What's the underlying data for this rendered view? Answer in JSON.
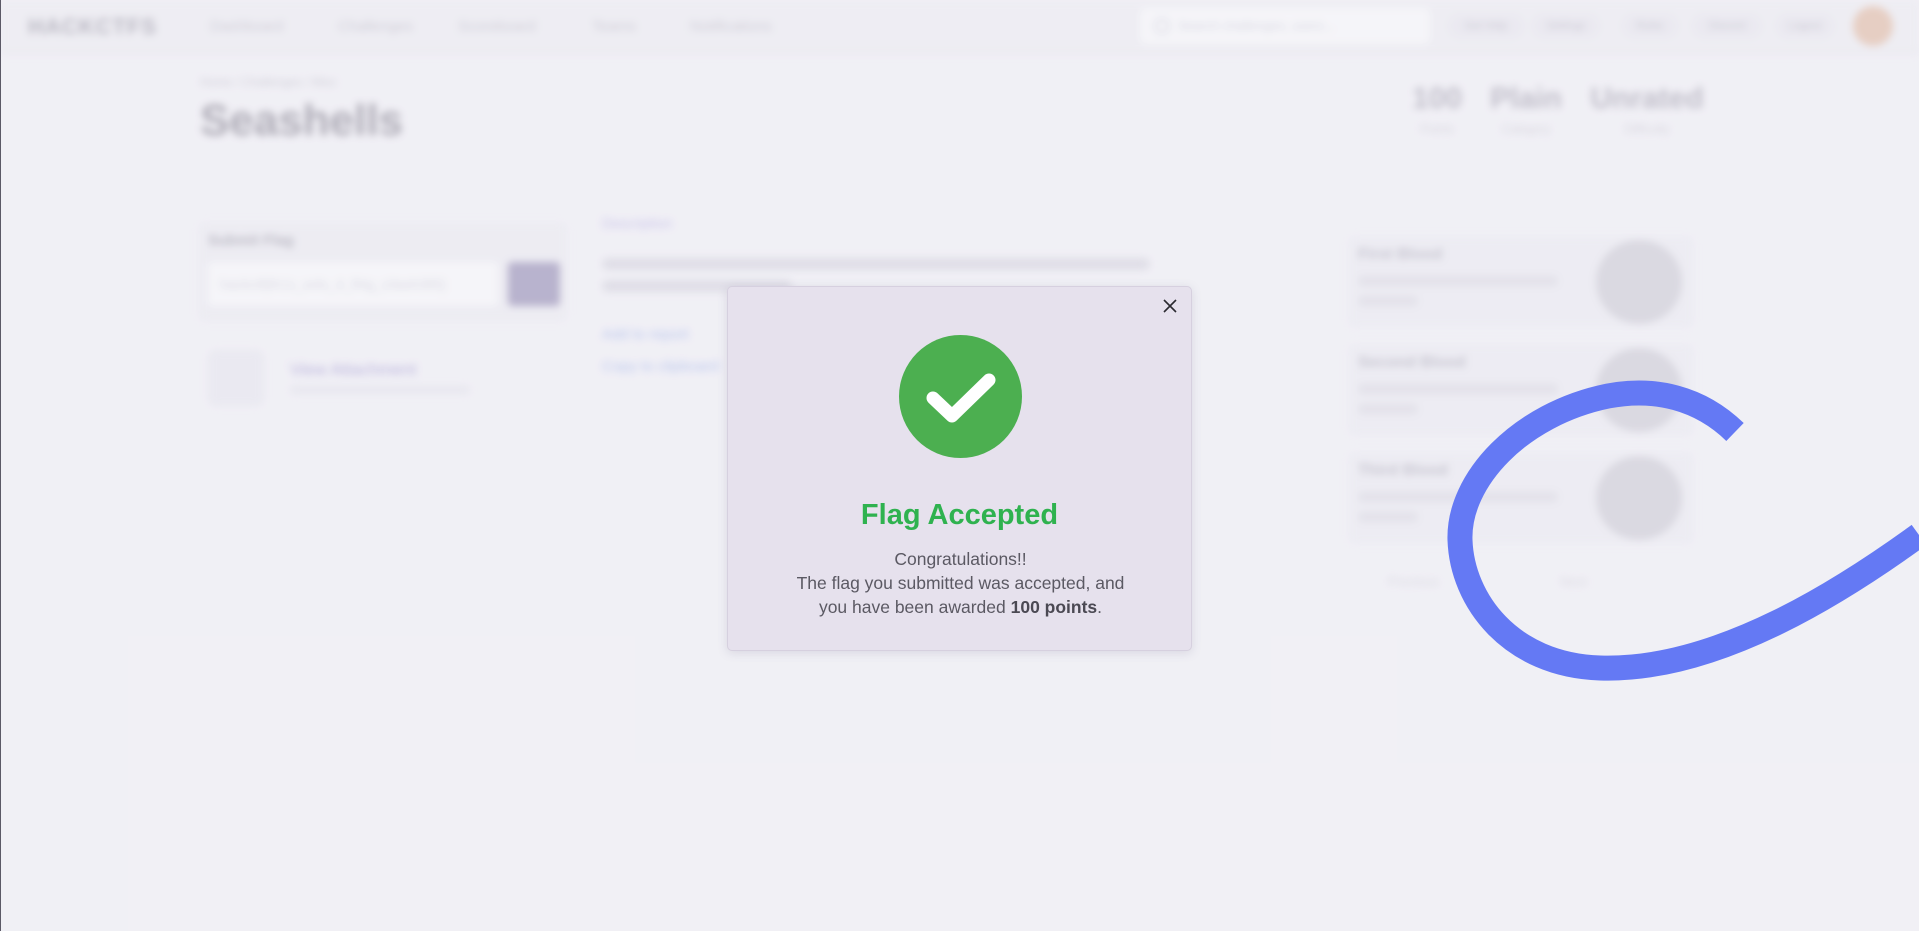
{
  "background": {
    "brand": "HACKCTFS",
    "nav_items": [
      "Dashboard",
      "Challenges",
      "Scoreboard",
      "Teams",
      "Notifications"
    ],
    "search_placeholder": "Search challenges, users...",
    "header_pills": [
      "Get Help",
      "Settings",
      "Rules",
      "Discord",
      "Logout"
    ],
    "breadcrumb": "Home  /  Challenges  /  Misc",
    "page_title": "Seashells",
    "stats": [
      {
        "value": "100",
        "label": "Points"
      },
      {
        "value": "Plain",
        "label": "Category"
      },
      {
        "value": "Unrated",
        "label": "Difficulty"
      }
    ],
    "submit_flag_label": "Submit Flag",
    "flag_input_value": "hackctf{th1s_w4s_4_fl4g_s3ash3ll5}",
    "file_name": "View Attachment",
    "description_link": "Description",
    "desc_links": [
      "Add to report",
      "Copy to clipboard"
    ],
    "side_cards": [
      "First Blood",
      "Second Blood",
      "Third Blood"
    ],
    "side_footer_left": "Previous",
    "side_footer_right": "Next"
  },
  "modal": {
    "title": "Flag Accepted",
    "line1": "Congratulations!!",
    "line2": "The flag you submitted was accepted, and",
    "line3_prefix": "you have been awarded ",
    "points_text": "100 points",
    "line3_suffix": ".",
    "close_icon": "close-icon",
    "status_icon": "check-circle-icon",
    "colors": {
      "success": "#4caf50",
      "title": "#2fb24f",
      "squiggle": "#6479f4"
    }
  }
}
